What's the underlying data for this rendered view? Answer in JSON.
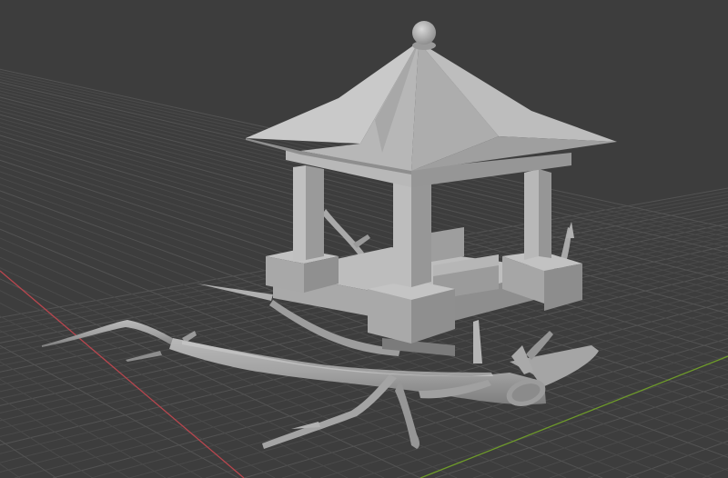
{
  "viewport": {
    "view": "perspective",
    "shading": "solid",
    "object": "gazebo-on-branches",
    "colors": {
      "background": "#3d3d3d",
      "grid_minor": "#4a4a4a",
      "grid_major": "#535353",
      "axis_x": "#b8464e",
      "axis_y": "#6e9a2a",
      "mesh_light": "#c3c3c3",
      "mesh_mid": "#a6a6a6",
      "mesh_dark": "#848484",
      "mesh_shadow": "#6a6a6a"
    }
  }
}
